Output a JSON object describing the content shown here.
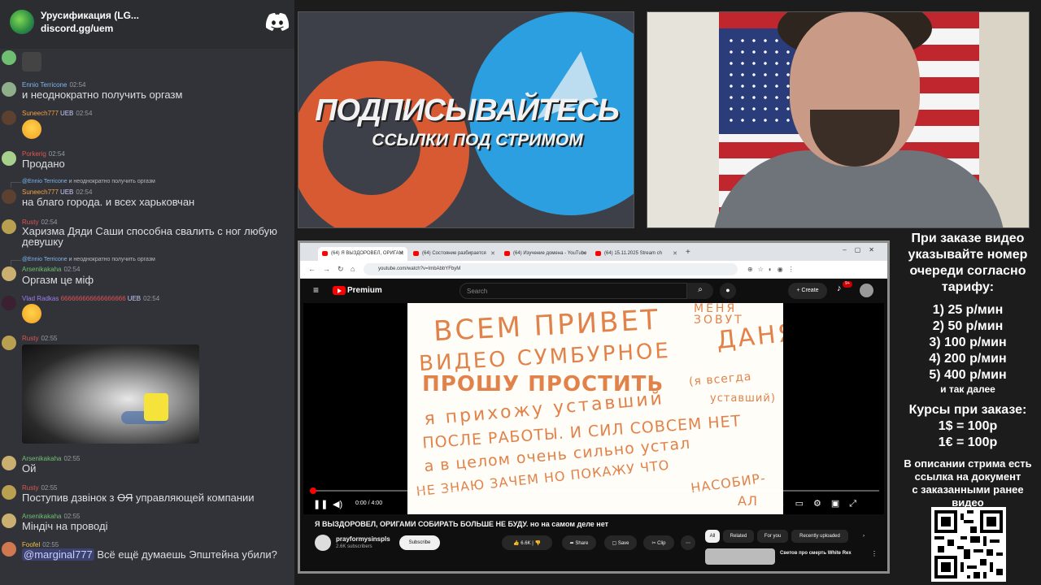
{
  "chat": {
    "server_name": "Урусификация (LG...",
    "server_invite": "discord.gg/uem",
    "messages": [
      {
        "user": "Ennio Terricone",
        "time": "02:54",
        "text": "и неоднократно получить оргазм",
        "color": "#7fb8f0"
      },
      {
        "user": "Suneech777",
        "badge": "UEB",
        "time": "02:54",
        "color": "#f5a142"
      },
      {
        "user": "Porkerig",
        "time": "02:54",
        "text": "Продано",
        "color": "#e05555"
      },
      {
        "reply_user": "@Ennio Terricone",
        "reply_text": "и неоднократно получить оргазм",
        "user": "Suneech777",
        "badge": "UEB",
        "time": "02:54",
        "text": "на благо города. и всех харьковчан",
        "color": "#f5a142"
      },
      {
        "user": "Rusty",
        "time": "02:54",
        "text": "Харизма Дяди Саши способна свалить с ног любую",
        "text2": "девушку",
        "color": "#e05555"
      },
      {
        "reply_user": "@Ennio Terricone",
        "reply_text": "и неоднократно получить оргазм",
        "user": "Arsenikakaha",
        "time": "02:54",
        "text": "Оргазм це міф",
        "color": "#6fbf73"
      },
      {
        "user": "Vlad Radkas",
        "extra": "666666666666666666",
        "badge": "UEB",
        "time": "02:54",
        "color": "#9e7ef0"
      },
      {
        "user": "Rusty",
        "time": "02:55",
        "color": "#e05555"
      },
      {
        "user": "Arsenikakaha",
        "time": "02:55",
        "text": "Ой",
        "color": "#6fbf73"
      },
      {
        "user": "Rusty",
        "time": "02:55",
        "text_pre": "Поступив дзвінок з ",
        "text_strike": "ОЯ",
        "text_post": " управляющей компании",
        "color": "#e05555"
      },
      {
        "user": "Arsenikakaha",
        "time": "02:55",
        "text": "Міндіч на проводі",
        "color": "#6fbf73"
      },
      {
        "user": "Foofel",
        "time": "02:55",
        "mention": "@marginal777",
        "text": " Всё ещё думаешь Эпштейна убили?",
        "color": "#f5c242"
      }
    ]
  },
  "promo": {
    "title": "ПОДПИСЫВАЙТЕСЬ",
    "subtitle": "ССЫЛКИ ПОД СТРИМОМ"
  },
  "browser": {
    "tabs": [
      "(64) Я ВЫЗДОРОВЕЛ, ОРИГАМ",
      "(64) Состояние разбирается",
      "(64) Изучение домена - YouTube",
      "(64) 15.11.2025 Stream ch"
    ],
    "url": "youtube.com/watch?v=ImbAbbYFbyM",
    "youtube": {
      "logo_text": "Premium",
      "search_placeholder": "Search",
      "create_label": "Create",
      "notif_count": "9+",
      "time": "0:00 / 4:00",
      "video_title": "Я ВЫЗДОРОВЕЛ, ОРИГАМИ СОБИРАТЬ БОЛЬШЕ НЕ БУДУ. но на самом деле нет",
      "channel": "prayformysinspls",
      "subscribers": "2.6K subscribers",
      "subscribe_label": "Subscribe",
      "likes": "6.6K",
      "share_label": "Share",
      "save_label": "Save",
      "clip_label": "Clip",
      "chips": [
        "All",
        "Related",
        "For you",
        "Recently uploaded"
      ],
      "rec_title": "Светов про смерть White Rex",
      "progress": 0.005
    },
    "handwriting": [
      "ВСЕМ ПРИВЕТ",
      "МЕНЯ ЗОВУТ",
      "ДАНЯ",
      "ВИДЕО СУМБУРНОЕ",
      "ПРОШУ ПРОСТИТЬ",
      "(я всегда",
      "я прихожу уставший",
      "уставший)",
      "ПОСЛЕ РАБОТЫ. И СИЛ СОВСЕМ НЕТ",
      "а в целом очень сильно устал",
      "НЕ ЗНАЮ ЗАЧЕМ НО ПОКАЖУ ЧТО",
      "НАСОБИР-",
      "АЛ"
    ]
  },
  "info": {
    "lines1": [
      "При заказе видео",
      "указывайте номер",
      "очереди согласно",
      "тарифу:"
    ],
    "tariffs": [
      "1) 25 р/мин",
      "2) 50 р/мин",
      "3) 100 р/мин",
      "4) 200 р/мин",
      "5) 400 р/мин"
    ],
    "etc": "и так далее",
    "courses_title": "Курсы при заказе:",
    "courses": [
      "1$ = 100р",
      "1€ = 100р"
    ],
    "lines2": [
      "В описании стрима есть",
      "ссылка на документ",
      "с заказанными ранее",
      "видео"
    ]
  }
}
